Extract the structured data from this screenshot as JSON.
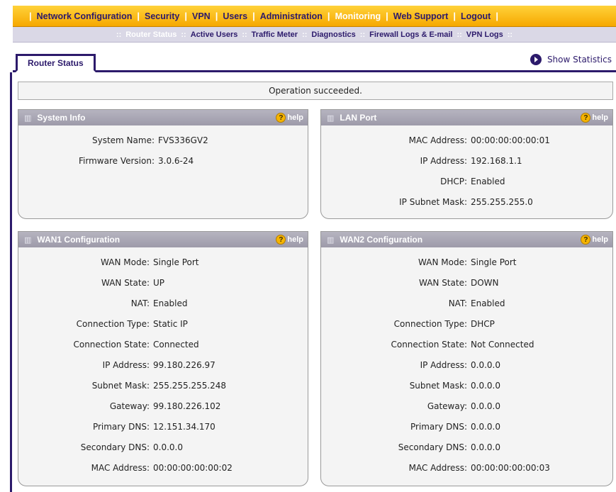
{
  "topnav": {
    "items": [
      {
        "label": "Network Configuration",
        "active": false
      },
      {
        "label": "Security",
        "active": false
      },
      {
        "label": "VPN",
        "active": false
      },
      {
        "label": "Users",
        "active": false
      },
      {
        "label": "Administration",
        "active": false
      },
      {
        "label": "Monitoring",
        "active": true
      },
      {
        "label": "Web Support",
        "active": false
      },
      {
        "label": "Logout",
        "active": false
      }
    ],
    "separator": "|"
  },
  "subnav": {
    "separator": "::",
    "items": [
      {
        "label": "Router Status",
        "active": true
      },
      {
        "label": "Active Users",
        "active": false
      },
      {
        "label": "Traffic Meter",
        "active": false
      },
      {
        "label": "Diagnostics",
        "active": false
      },
      {
        "label": "Firewall Logs & E-mail",
        "active": false
      },
      {
        "label": "VPN Logs",
        "active": false
      }
    ]
  },
  "tab": {
    "label": "Router Status"
  },
  "show_statistics": {
    "label": "Show Statistics",
    "icon": "arrow-right-circle-icon"
  },
  "message": "Operation succeeded.",
  "help_label": "help",
  "panels": {
    "system_info": {
      "title": "System Info",
      "rows": [
        {
          "k": "System Name:",
          "v": "FVS336GV2"
        },
        {
          "k": "Firmware Version:",
          "v": "3.0.6-24"
        }
      ]
    },
    "lan_port": {
      "title": "LAN Port",
      "rows": [
        {
          "k": "MAC Address:",
          "v": "00:00:00:00:00:01"
        },
        {
          "k": "IP Address:",
          "v": "192.168.1.1"
        },
        {
          "k": "DHCP:",
          "v": "Enabled"
        },
        {
          "k": "IP Subnet Mask:",
          "v": "255.255.255.0"
        }
      ]
    },
    "wan1": {
      "title": "WAN1 Configuration",
      "rows": [
        {
          "k": "WAN Mode:",
          "v": "Single Port"
        },
        {
          "k": "WAN State:",
          "v": "UP"
        },
        {
          "k": "NAT:",
          "v": "Enabled"
        },
        {
          "k": "Connection Type:",
          "v": "Static IP"
        },
        {
          "k": "Connection State:",
          "v": "Connected"
        },
        {
          "k": "IP Address:",
          "v": "99.180.226.97"
        },
        {
          "k": "Subnet Mask:",
          "v": "255.255.255.248"
        },
        {
          "k": "Gateway:",
          "v": "99.180.226.102"
        },
        {
          "k": "Primary DNS:",
          "v": "12.151.34.170"
        },
        {
          "k": "Secondary DNS:",
          "v": "0.0.0.0"
        },
        {
          "k": "MAC Address:",
          "v": "00:00:00:00:00:02"
        }
      ]
    },
    "wan2": {
      "title": "WAN2 Configuration",
      "rows": [
        {
          "k": "WAN Mode:",
          "v": "Single Port"
        },
        {
          "k": "WAN State:",
          "v": "DOWN"
        },
        {
          "k": "NAT:",
          "v": "Enabled"
        },
        {
          "k": "Connection Type:",
          "v": "DHCP"
        },
        {
          "k": "Connection State:",
          "v": "Not Connected"
        },
        {
          "k": "IP Address:",
          "v": "0.0.0.0"
        },
        {
          "k": "Subnet Mask:",
          "v": "0.0.0.0"
        },
        {
          "k": "Gateway:",
          "v": "0.0.0.0"
        },
        {
          "k": "Primary DNS:",
          "v": "0.0.0.0"
        },
        {
          "k": "Secondary DNS:",
          "v": "0.0.0.0"
        },
        {
          "k": "MAC Address:",
          "v": "00:00:00:00:00:03"
        }
      ]
    }
  }
}
